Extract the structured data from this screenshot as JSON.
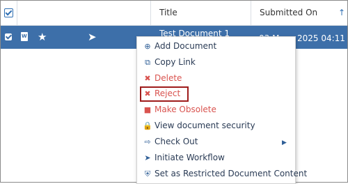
{
  "header": {
    "col_title": "Title",
    "col_submitted": "Submitted On",
    "sort_icon": "↑"
  },
  "row": {
    "title": "Test Document 1",
    "date_left": "03 M",
    "date_right": "2025 04:11"
  },
  "menu": {
    "items": [
      {
        "label": "Add Document",
        "icon": "⊕"
      },
      {
        "label": "Copy Link",
        "icon": "⧉"
      },
      {
        "label": "Delete",
        "icon": "✖"
      },
      {
        "label": "Reject",
        "icon": "✖"
      },
      {
        "label": "Make Obsolete",
        "icon": "■"
      },
      {
        "label": "View document security",
        "icon": "🔒"
      },
      {
        "label": "Check Out",
        "icon": "⇨"
      },
      {
        "label": "Initiate Workflow",
        "icon": "➤"
      },
      {
        "label": "Set as Restricted Document Content",
        "icon": "⛨"
      }
    ],
    "submenu_arrow": "▶"
  },
  "colors": {
    "row_selected": "#3d6fa9",
    "danger": "#d9534f",
    "highlight_border": "#9e1b1b",
    "menu_text": "#2a3b55"
  }
}
